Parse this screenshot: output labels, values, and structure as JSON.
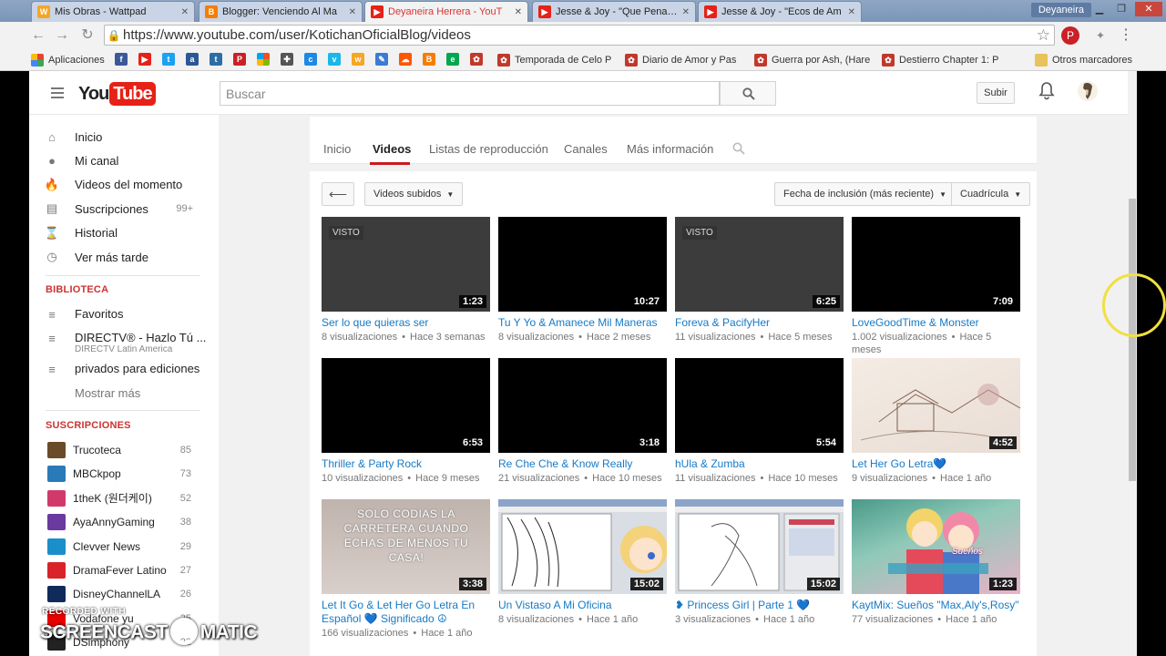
{
  "browser": {
    "tabs": [
      {
        "title": "Mis Obras - Wattpad",
        "icon": "wattpad-icon",
        "color": "#f5a623"
      },
      {
        "title": "Blogger: Venciendo Al Ma",
        "icon": "blogger-icon",
        "color": "#f57d00"
      },
      {
        "title": "Deyaneira Herrera - YouT",
        "icon": "youtube-icon",
        "color": "#e62117"
      },
      {
        "title": "Jesse & Joy - \"Que Pena M",
        "icon": "youtube-icon",
        "color": "#e62117"
      },
      {
        "title": "Jesse & Joy - \"Ecos de Am",
        "icon": "youtube-icon",
        "color": "#e62117"
      }
    ],
    "profile_name": "Deyaneira",
    "url": "https://www.youtube.com/user/KotichanOficialBlog/videos",
    "bookmarks": {
      "apps_label": "Aplicaciones",
      "folders": [
        "Temporada de Celo P",
        "Diario de Amor y Pas",
        "Guerra por Ash, (Hare",
        "Destierro Chapter 1: P"
      ],
      "other_label": "Otros marcadores"
    }
  },
  "youtube": {
    "logo": {
      "you": "You",
      "tube": "Tube"
    },
    "search_placeholder": "Buscar",
    "upload_label": "Subir",
    "sidebar": {
      "main": [
        {
          "label": "Inicio",
          "icon": "home-icon"
        },
        {
          "label": "Mi canal",
          "icon": "user-icon"
        },
        {
          "label": "Videos del momento",
          "icon": "flame-icon"
        },
        {
          "label": "Suscripciones",
          "icon": "subscriptions-icon",
          "count": "99+"
        },
        {
          "label": "Historial",
          "icon": "history-icon"
        },
        {
          "label": "Ver más tarde",
          "icon": "clock-icon"
        }
      ],
      "library_title": "BIBLIOTECA",
      "library": [
        {
          "label": "Favoritos"
        },
        {
          "label": "DIRECTV® - Hazlo Tú ...",
          "sub": "DIRECTV Latin America"
        },
        {
          "label": "privados para ediciones"
        }
      ],
      "show_more": "Mostrar más",
      "subs_title": "SUSCRIPCIONES",
      "subscriptions": [
        {
          "name": "Trucoteca",
          "count": "85"
        },
        {
          "name": "MBCkpop",
          "count": "73"
        },
        {
          "name": "1theK (원더케이)",
          "count": "52"
        },
        {
          "name": "AyaAnnyGaming",
          "count": "38"
        },
        {
          "name": "Clevver News",
          "count": "29"
        },
        {
          "name": "DramaFever Latino",
          "count": "27"
        },
        {
          "name": "DisneyChannelLA",
          "count": "26"
        },
        {
          "name": "Vodafone yu",
          "count": "25"
        },
        {
          "name": "DSimphony",
          "count": "22"
        }
      ]
    },
    "channel_tabs": [
      "Inicio",
      "Videos",
      "Listas de reproducción",
      "Canales",
      "Más información"
    ],
    "controls": {
      "filter": "Videos subidos",
      "sort": "Fecha de inclusión (más reciente)",
      "view": "Cuadrícula"
    },
    "videos": [
      {
        "title": "Ser lo que quieras ser",
        "views": "8 visualizaciones",
        "age": "Hace 3 semanas",
        "duration": "1:23",
        "seen": "VISTO"
      },
      {
        "title": "Tu Y Yo & Amanece Mil Maneras",
        "views": "8 visualizaciones",
        "age": "Hace 2 meses",
        "duration": "10:27"
      },
      {
        "title": "Foreva & PacifyHer",
        "views": "11 visualizaciones",
        "age": "Hace 5 meses",
        "duration": "6:25",
        "seen": "VISTO"
      },
      {
        "title": "LoveGoodTime & Monster",
        "views": "1.002 visualizaciones",
        "age": "Hace 5 meses",
        "duration": "7:09"
      },
      {
        "title": "Thriller & Party Rock",
        "views": "10 visualizaciones",
        "age": "Hace 9 meses",
        "duration": "6:53"
      },
      {
        "title": "Re Che Che & Know Really",
        "views": "21 visualizaciones",
        "age": "Hace 10 meses",
        "duration": "3:18"
      },
      {
        "title": "hUla & Zumba",
        "views": "11 visualizaciones",
        "age": "Hace 10 meses",
        "duration": "5:54"
      },
      {
        "title": "Let Her Go Letra💙",
        "views": "9 visualizaciones",
        "age": "Hace 1 año",
        "duration": "4:52",
        "art": "sketch"
      },
      {
        "title": "Let It Go & Let Her Go Letra En Español 💙 Significado ☮",
        "views": "166 visualizaciones",
        "age": "Hace 1 año",
        "duration": "3:38",
        "art": "text",
        "art_text": "SOLO CODIAS LA CARRETERA CUANDO ECHAS DE MENOS TU CASA!"
      },
      {
        "title": "Un Vistaso A Mi Oficina",
        "views": "8 visualizaciones",
        "age": "Hace 1 año",
        "duration": "15:02",
        "art": "editor"
      },
      {
        "title": "❥ Princess Girl | Parte 1 💙",
        "views": "3 visualizaciones",
        "age": "Hace 1 año",
        "duration": "15:02",
        "art": "editor2"
      },
      {
        "title": "KaytMix: Sueños \"Max,Aly's,Rosy\"",
        "views": "77 visualizaciones",
        "age": "Hace 1 año",
        "duration": "1:23",
        "art": "anime",
        "art_text": "Sueños"
      }
    ]
  },
  "watermark": {
    "recorded": "RECORDED WITH",
    "brand_a": "SCREENCAST",
    "brand_b": "MATIC"
  },
  "colors": {
    "accent": "#cc181e",
    "link": "#167ac6",
    "brand_red": "#e62117"
  }
}
